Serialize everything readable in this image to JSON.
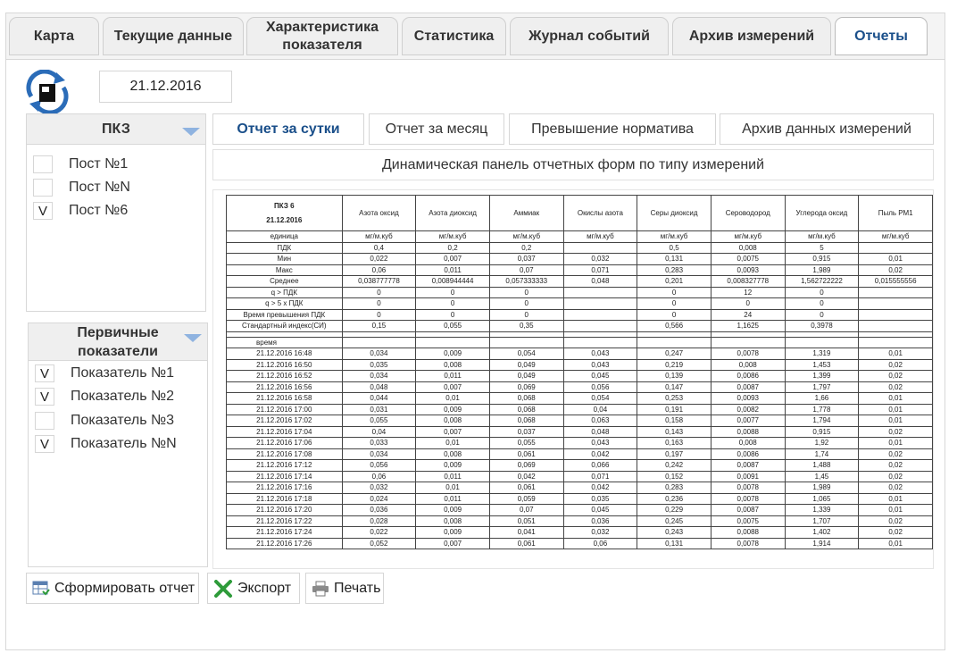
{
  "tabs": [
    {
      "label": "Карта",
      "active": false
    },
    {
      "label": "Текущие данные",
      "active": false
    },
    {
      "label": "Характеристика показателя",
      "active": false
    },
    {
      "label": "Статистика",
      "active": false
    },
    {
      "label": "Журнал событий",
      "active": false
    },
    {
      "label": "Архив измерений",
      "active": false
    },
    {
      "label": "Отчеты",
      "active": true
    }
  ],
  "date": "21.12.2016",
  "posts_panel": {
    "title": "ПКЗ",
    "items": [
      {
        "check": "",
        "label": "Пост №1"
      },
      {
        "check": "",
        "label": "Пост №N"
      },
      {
        "check": "V",
        "label": "Пост №6"
      }
    ]
  },
  "indicators_panel": {
    "title": "Первичные показатели",
    "items": [
      {
        "check": "V",
        "label": "Показатель №1"
      },
      {
        "check": "V",
        "label": "Показатель №2"
      },
      {
        "check": "",
        "label": "Показатель №3"
      },
      {
        "check": "V",
        "label": "Показатель №N"
      }
    ]
  },
  "report_tabs": [
    {
      "label": "Отчет за сутки",
      "active": true
    },
    {
      "label": "Отчет за месяц",
      "active": false
    },
    {
      "label": "Превышение норматива",
      "active": false
    },
    {
      "label": "Архив данных измерений",
      "active": false
    }
  ],
  "banner": "Динамическая панель отчетных форм по типу измерений",
  "report": {
    "station": "ПКЗ 6",
    "date": "21.12.2016",
    "columns": [
      "Азота оксид",
      "Азота диоксид",
      "Аммиак",
      "Окислы азота",
      "Серы диоксид",
      "Сероводород",
      "Углерода оксид",
      "Пыль РМ1"
    ],
    "summary": [
      [
        "единица",
        "мг/м.куб",
        "мг/м.куб",
        "мг/м.куб",
        "мг/м.куб",
        "мг/м.куб",
        "мг/м.куб",
        "мг/м.куб",
        "мг/м.куб"
      ],
      [
        "ПДК",
        "0,4",
        "0,2",
        "0,2",
        "",
        "0,5",
        "0,008",
        "5",
        ""
      ],
      [
        "Мин",
        "0,022",
        "0,007",
        "0,037",
        "0,032",
        "0,131",
        "0,0075",
        "0,915",
        "0,01"
      ],
      [
        "Макс",
        "0,06",
        "0,011",
        "0,07",
        "0,071",
        "0,283",
        "0,0093",
        "1,989",
        "0,02"
      ],
      [
        "Среднее",
        "0,038777778",
        "0,008944444",
        "0,057333333",
        "0,048",
        "0,201",
        "0,008327778",
        "1,562722222",
        "0,015555556"
      ],
      [
        "q > ПДК",
        "0",
        "0",
        "0",
        "",
        "0",
        "12",
        "0",
        ""
      ],
      [
        "q > 5 x ПДК",
        "0",
        "0",
        "0",
        "",
        "0",
        "0",
        "0",
        ""
      ],
      [
        "Время превышения ПДК",
        "0",
        "0",
        "0",
        "",
        "0",
        "24",
        "0",
        ""
      ],
      [
        "Стандартный индекс(СИ)",
        "0,15",
        "0,055",
        "0,35",
        "",
        "0,566",
        "1,1625",
        "0,3978",
        ""
      ]
    ],
    "time_label": "время",
    "rows": [
      [
        "21.12.2016 16:48",
        "0,034",
        "0,009",
        "0,054",
        "0,043",
        "0,247",
        "0,0078",
        "1,319",
        "0,01"
      ],
      [
        "21.12.2016 16:50",
        "0,035",
        "0,008",
        "0,049",
        "0,043",
        "0,219",
        "0,008",
        "1,453",
        "0,02"
      ],
      [
        "21.12.2016 16:52",
        "0,034",
        "0,011",
        "0,049",
        "0,045",
        "0,139",
        "0,0086",
        "1,399",
        "0,02"
      ],
      [
        "21.12.2016 16:56",
        "0,048",
        "0,007",
        "0,069",
        "0,056",
        "0,147",
        "0,0087",
        "1,797",
        "0,02"
      ],
      [
        "21.12.2016 16:58",
        "0,044",
        "0,01",
        "0,068",
        "0,054",
        "0,253",
        "0,0093",
        "1,66",
        "0,01"
      ],
      [
        "21.12.2016 17:00",
        "0,031",
        "0,009",
        "0,068",
        "0,04",
        "0,191",
        "0,0082",
        "1,778",
        "0,01"
      ],
      [
        "21.12.2016 17:02",
        "0,055",
        "0,008",
        "0,068",
        "0,063",
        "0,158",
        "0,0077",
        "1,794",
        "0,01"
      ],
      [
        "21.12.2016 17:04",
        "0,04",
        "0,007",
        "0,037",
        "0,048",
        "0,143",
        "0,0088",
        "0,915",
        "0,02"
      ],
      [
        "21.12.2016 17:06",
        "0,033",
        "0,01",
        "0,055",
        "0,043",
        "0,163",
        "0,008",
        "1,92",
        "0,01"
      ],
      [
        "21.12.2016 17:08",
        "0,034",
        "0,008",
        "0,061",
        "0,042",
        "0,197",
        "0,0086",
        "1,74",
        "0,02"
      ],
      [
        "21.12.2016 17:12",
        "0,056",
        "0,009",
        "0,069",
        "0,066",
        "0,242",
        "0,0087",
        "1,488",
        "0,02"
      ],
      [
        "21.12.2016 17:14",
        "0,06",
        "0,011",
        "0,042",
        "0,071",
        "0,152",
        "0,0091",
        "1,45",
        "0,02"
      ],
      [
        "21.12.2016 17:16",
        "0,032",
        "0,01",
        "0,061",
        "0,042",
        "0,283",
        "0,0078",
        "1,989",
        "0,02"
      ],
      [
        "21.12.2016 17:18",
        "0,024",
        "0,011",
        "0,059",
        "0,035",
        "0,236",
        "0,0078",
        "1,065",
        "0,01"
      ],
      [
        "21.12.2016 17:20",
        "0,036",
        "0,009",
        "0,07",
        "0,045",
        "0,229",
        "0,0087",
        "1,339",
        "0,01"
      ],
      [
        "21.12.2016 17:22",
        "0,028",
        "0,008",
        "0,051",
        "0,036",
        "0,245",
        "0,0075",
        "1,707",
        "0,02"
      ],
      [
        "21.12.2016 17:24",
        "0,022",
        "0,009",
        "0,041",
        "0,032",
        "0,243",
        "0,0088",
        "1,402",
        "0,02"
      ],
      [
        "21.12.2016 17:26",
        "0,052",
        "0,007",
        "0,061",
        "0,06",
        "0,131",
        "0,0078",
        "1,914",
        "0,01"
      ]
    ]
  },
  "buttons": {
    "generate": "Сформировать отчет",
    "export": "Экспорт",
    "print": "Печать"
  },
  "icons": {
    "refresh": "refresh-icon",
    "dropdown": "triangle-down-icon",
    "generate": "table-report-icon",
    "export": "excel-x-icon",
    "print": "printer-icon"
  },
  "colors": {
    "accent": "#1a4f8a",
    "dropdown": "#8fb3e0",
    "export_green": "#2e9b3a"
  }
}
